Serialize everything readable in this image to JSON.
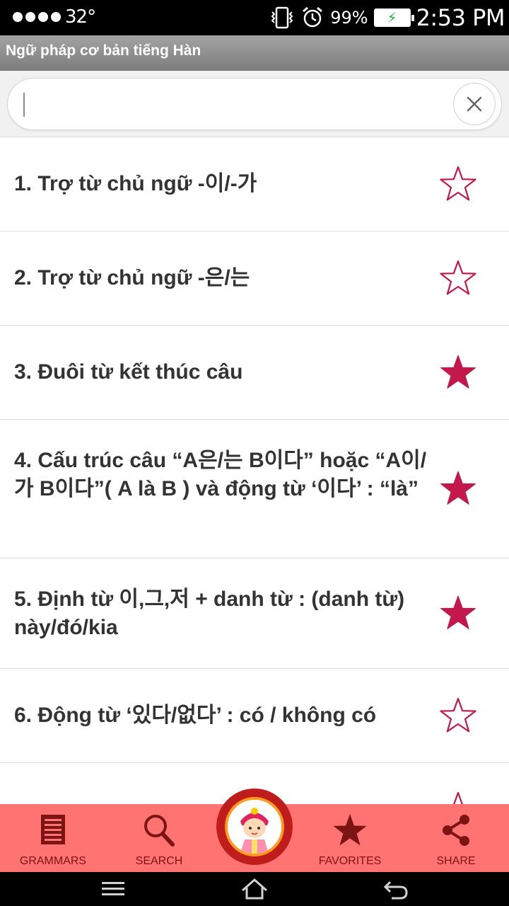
{
  "status_bar": {
    "temperature": "32°",
    "battery_percent": "99%",
    "time": "2:53 PM"
  },
  "header": {
    "title": "Ngữ pháp cơ bản tiếng Hàn"
  },
  "search": {
    "value": "",
    "placeholder": ""
  },
  "list": {
    "items": [
      {
        "label": "1. Trợ từ chủ ngữ -이/-가",
        "favorite": false
      },
      {
        "label": "2. Trợ từ chủ ngữ -은/는",
        "favorite": false
      },
      {
        "label": "3. Đuôi từ kết thúc câu",
        "favorite": true
      },
      {
        "label": "4. Cấu trúc câu “A은/는 B이다” hoặc “A이/가 B이다”( A là B ) và động từ ‘이다’ : “là”",
        "favorite": true
      },
      {
        "label": "5. Định từ 이,그,저 + danh từ : (danh từ) này/đó/kia",
        "favorite": true
      },
      {
        "label": "6. Động từ ‘있다/없다’ : có / không có",
        "favorite": false
      }
    ]
  },
  "bottom_nav": {
    "grammars_label": "GRAMMARS",
    "search_label": "SEARCH",
    "favorites_label": "FAVORITES",
    "share_label": "SHARE"
  },
  "colors": {
    "accent_star": "#c2184b",
    "bottom_nav_bg": "#ff7373",
    "bottom_nav_icon": "#7d1414",
    "center_button": "#bf1c1c"
  }
}
